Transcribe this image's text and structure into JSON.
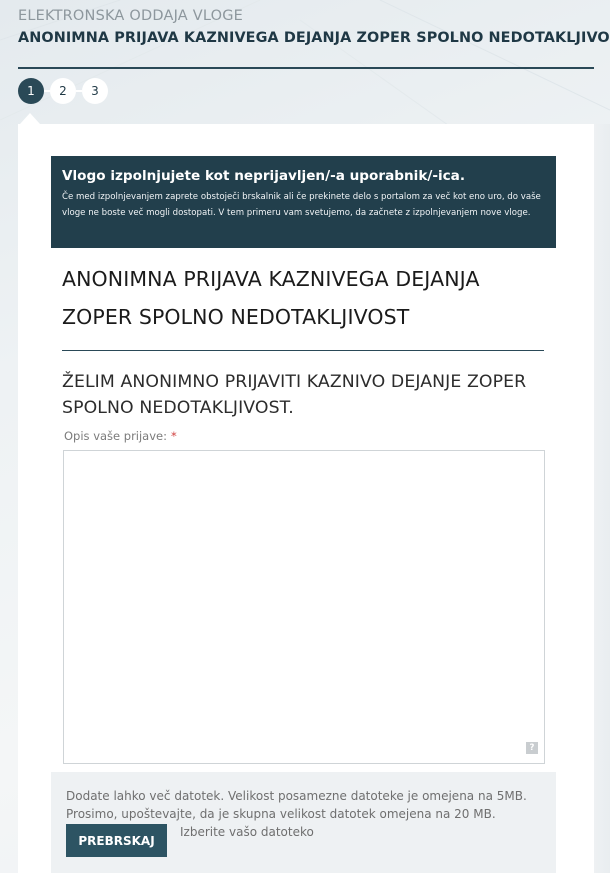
{
  "header": {
    "breadcrumb": "ELEKTRONSKA ODDAJA VLOGE",
    "title": "ANONIMNA PRIJAVA KAZNIVEGA DEJANJA ZOPER SPOLNO NEDOTAKLJIVOST"
  },
  "steps": [
    {
      "label": "1",
      "active": true
    },
    {
      "label": "2",
      "active": false
    },
    {
      "label": "3",
      "active": false
    }
  ],
  "notice": {
    "title": "Vlogo izpolnjujete kot neprijavljen/-a uporabnik/-ica.",
    "text": "Če med izpolnjevanjem zaprete obstoječi brskalnik ali če prekinete delo s portalom za več kot eno uro, do vaše vloge ne boste več mogli dostopati. V tem primeru vam svetujemo, da začnete z izpolnjevanjem nove vloge."
  },
  "form": {
    "title": "ANONIMNA PRIJAVA KAZNIVEGA DEJANJA ZOPER SPOLNO NEDOTAKLJIVOST",
    "section_title": "ŽELIM ANONIMNO PRIJAVITI KAZNIVO DEJANJE ZOPER SPOLNO NEDOTAKLJIVOST.",
    "description_label": "Opis vaše prijave:",
    "required_marker": "*",
    "description_value": "",
    "help_icon": "?"
  },
  "upload": {
    "info_line1": "Dodate lahko več datotek. Velikost posamezne datoteke je omejena na 5MB.",
    "info_line2": "Prosimo, upoštevajte, da je skupna velikost datotek omejena na 20 MB.",
    "browse_label": "PREBRSKAJ",
    "file_label": "Izberite vašo datoteko"
  },
  "colors": {
    "accent": "#2a4957",
    "notice_bg": "#223f4c",
    "button_bg": "#2d5463",
    "required": "#d0403f"
  }
}
